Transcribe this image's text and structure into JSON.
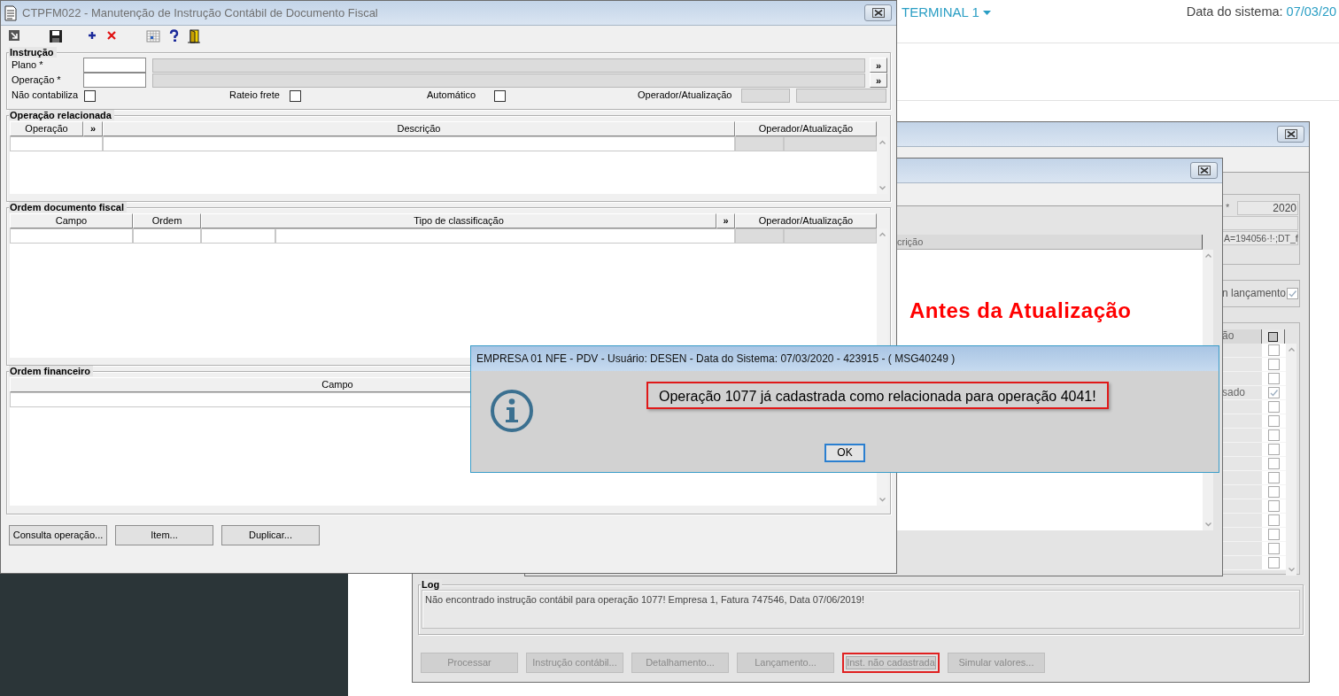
{
  "page_header": {
    "terminal": "TERMINAL 1",
    "date_label": "Data do sistema:",
    "date_value": "07/03/20"
  },
  "back_window": {
    "year": {
      "label": "*",
      "value": "2020"
    },
    "filter_value": "A=194056·!·;DT_f",
    "launch": {
      "label": "n lançamento",
      "checked": true
    },
    "list": {
      "column": "ão",
      "rows": [
        {
          "checked": false
        },
        {
          "checked": false
        },
        {
          "checked": false
        },
        {
          "text": "sado",
          "checked": true
        },
        {
          "checked": false
        },
        {
          "checked": false
        },
        {
          "checked": false
        },
        {
          "checked": false
        },
        {
          "checked": false
        },
        {
          "checked": false
        },
        {
          "checked": false
        },
        {
          "checked": false
        },
        {
          "checked": false
        },
        {
          "checked": false
        },
        {
          "checked": false
        },
        {
          "checked": false
        }
      ]
    },
    "log": {
      "legend": "Log",
      "text": "Não encontrado instrução contábil para operação 1077! Empresa 1, Fatura 747546, Data 07/06/2019!"
    },
    "buttons": [
      {
        "label": "Processar",
        "disabled": true,
        "highlighted": false
      },
      {
        "label": "Instrução contábil...",
        "disabled": true,
        "highlighted": false
      },
      {
        "label": "Detalhamento...",
        "disabled": true,
        "highlighted": false
      },
      {
        "label": "Lançamento...",
        "disabled": true,
        "highlighted": false
      },
      {
        "label": "Inst. não cadastrada",
        "disabled": true,
        "highlighted": true
      },
      {
        "label": "Simular valores...",
        "disabled": true,
        "highlighted": false
      }
    ]
  },
  "middle_window": {
    "column": "crição"
  },
  "annotation": "Antes da Atualização",
  "main_window": {
    "title": "CTPFM022 - Manutenção de Instrução Contábil de Documento Fiscal",
    "instrucao": {
      "legend": "Instrução",
      "rows": [
        {
          "label": "Plano *",
          "lookup": "»"
        },
        {
          "label": "Operação *",
          "lookup": "»"
        }
      ],
      "options": [
        {
          "label": "Não contabiliza",
          "checked": false
        },
        {
          "label": "Rateio frete",
          "checked": false
        },
        {
          "label": "Automático",
          "checked": false
        }
      ],
      "operator_label": "Operador/Atualização"
    },
    "operacao_relacionada": {
      "legend": "Operação relacionada",
      "columns": [
        {
          "text": "Operação",
          "kind": "header"
        },
        {
          "text": "»",
          "kind": "button"
        },
        {
          "text": "Descrição",
          "kind": "header"
        },
        {
          "text": "Operador/Atualização",
          "kind": "header"
        }
      ]
    },
    "ordem_documento_fiscal": {
      "legend": "Ordem documento fiscal",
      "columns": [
        {
          "text": "Campo",
          "kind": "header"
        },
        {
          "text": "Ordem",
          "kind": "header"
        },
        {
          "text": "Tipo de classificação",
          "kind": "header"
        },
        {
          "text": "»",
          "kind": "button"
        },
        {
          "text": "Operador/Atualização",
          "kind": "header"
        }
      ]
    },
    "ordem_financeiro": {
      "legend": "Ordem financeiro",
      "columns": [
        {
          "text": "Campo",
          "kind": "header"
        }
      ]
    },
    "buttons": [
      "Consulta operação...",
      "Item...",
      "Duplicar..."
    ]
  },
  "dialog": {
    "title": "EMPRESA 01 NFE - PDV - Usuário: DESEN - Data do Sistema: 07/03/2020 - 423915 - ( MSG40249 )",
    "message": {
      "text": "Operação 1077 já cadastrada como relacionada para operação 4041!",
      "highlighted": true
    },
    "ok": "OK"
  }
}
